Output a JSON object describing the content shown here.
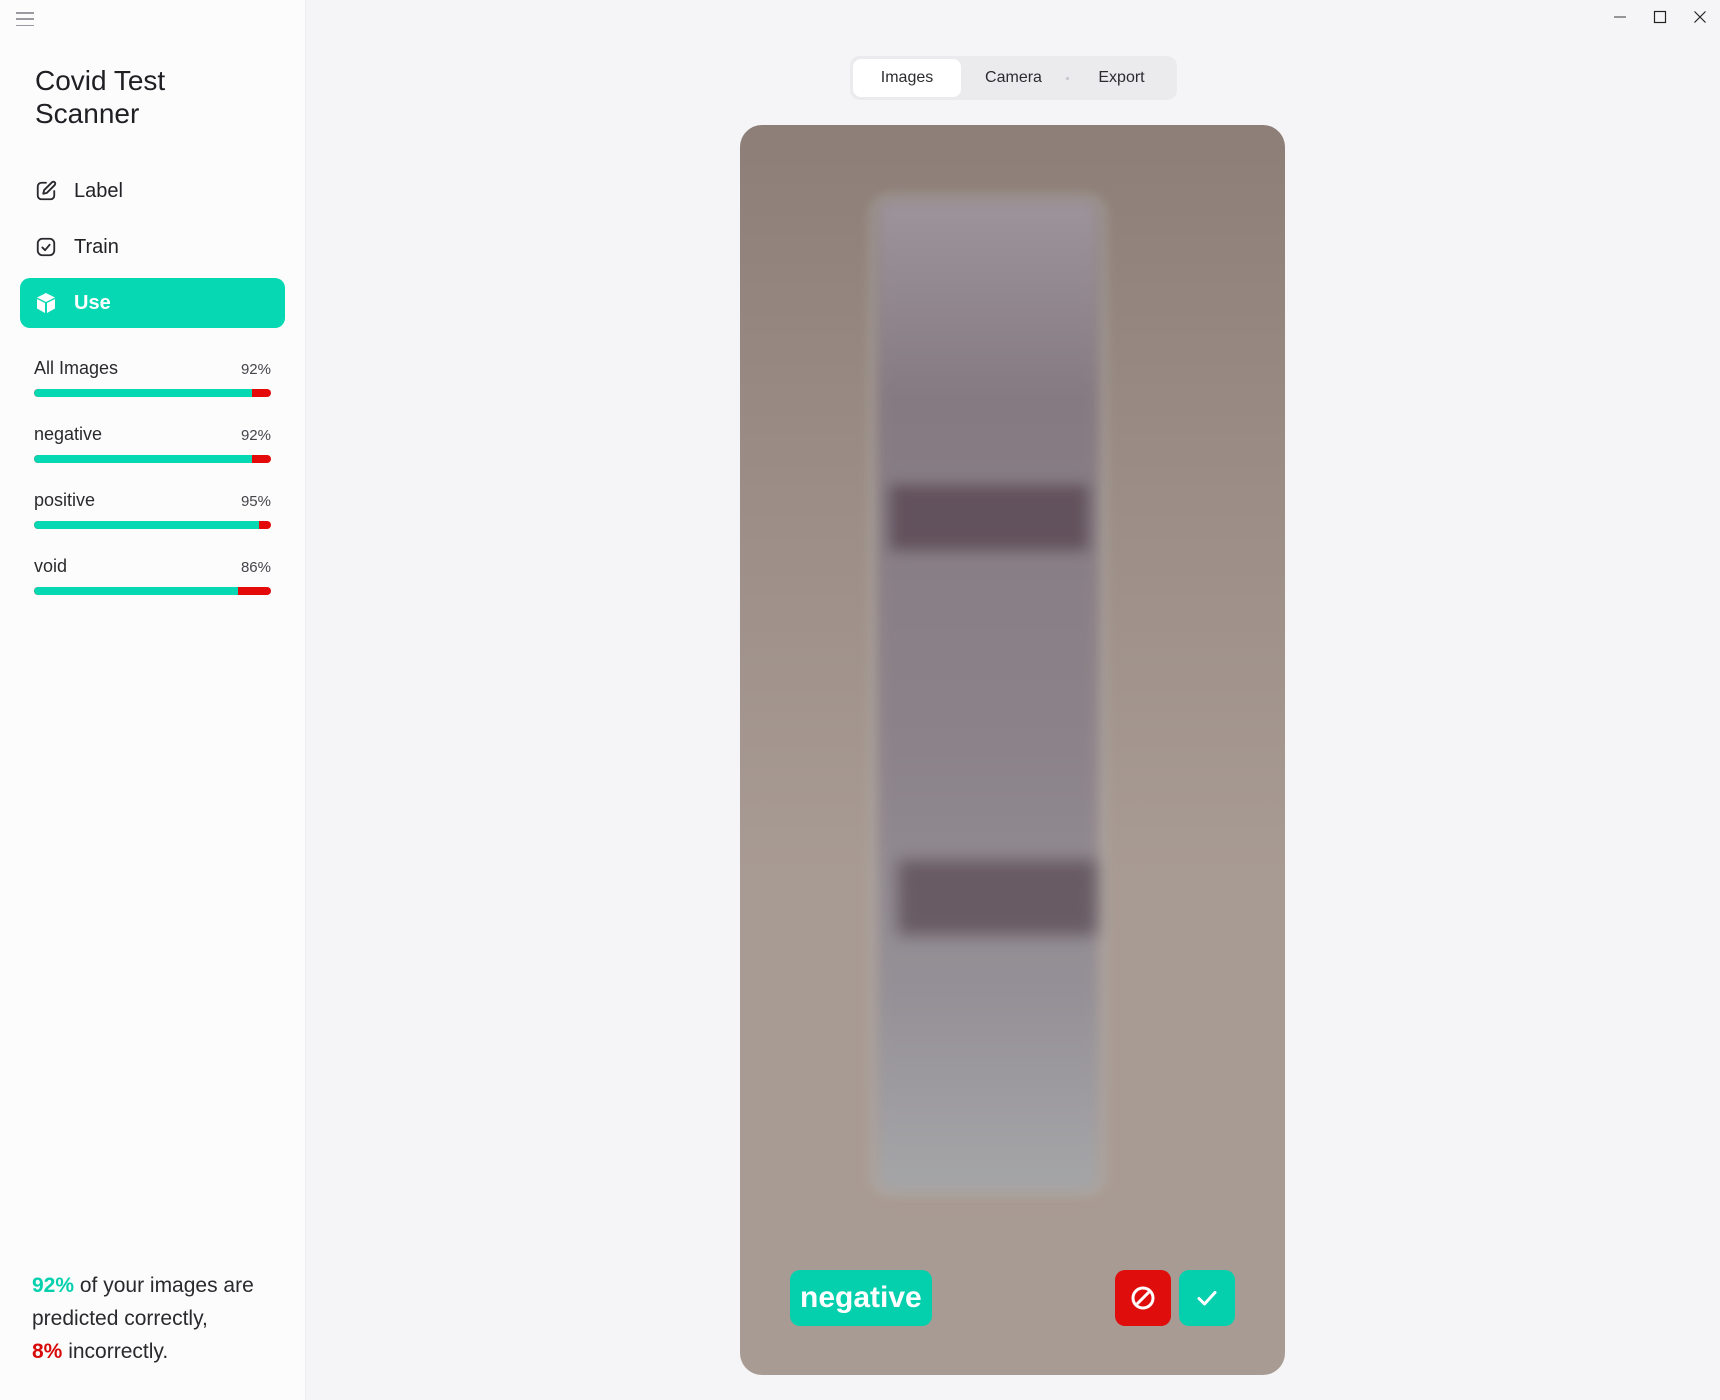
{
  "window": {
    "controls": [
      "minimize",
      "maximize",
      "close"
    ]
  },
  "sidebar": {
    "menu_icon": "hamburger-icon",
    "app_title": "Covid Test Scanner",
    "nav": [
      {
        "label": "Label",
        "icon": "pencil-square-icon",
        "active": false
      },
      {
        "label": "Train",
        "icon": "check-square-icon",
        "active": false
      },
      {
        "label": "Use",
        "icon": "cube-icon",
        "active": true
      }
    ],
    "stats": [
      {
        "name": "All Images",
        "pct_label": "92%",
        "correct_fraction": 0.92
      },
      {
        "name": "negative",
        "pct_label": "92%",
        "correct_fraction": 0.92
      },
      {
        "name": "positive",
        "pct_label": "95%",
        "correct_fraction": 0.95
      },
      {
        "name": "void",
        "pct_label": "86%",
        "correct_fraction": 0.86
      }
    ],
    "summary": {
      "correct_pct": "92%",
      "text1": " of your images are predicted correctly,",
      "incorrect_pct": "8%",
      "text2": " incorrectly."
    }
  },
  "tabs": [
    {
      "label": "Images",
      "selected": true
    },
    {
      "label": "Camera",
      "selected": false
    },
    {
      "label": "Export",
      "selected": false
    }
  ],
  "preview": {
    "subject": "covid test strip photo",
    "predicted_label": "negative",
    "reject_icon": "ban-icon",
    "accept_icon": "check-icon"
  },
  "colors": {
    "accent": "#05d8b2",
    "error": "#e00d0d",
    "sidebar_bg": "#fcfcfd",
    "main_bg": "#f5f5f7"
  }
}
